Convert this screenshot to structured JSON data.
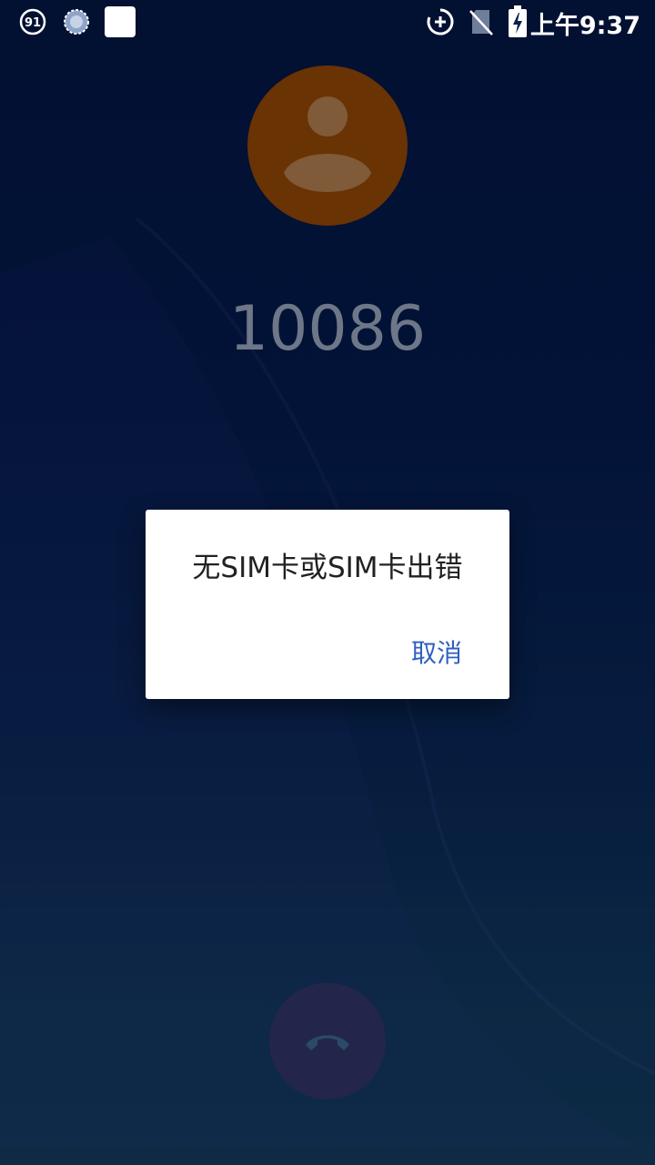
{
  "status_bar": {
    "time": "上午9:37",
    "icons": [
      "app-notification-icon",
      "sync-progress-icon",
      "blank-notification-icon",
      "data-saver-icon",
      "no-sim-icon",
      "battery-charging-icon"
    ]
  },
  "call": {
    "number": "10086",
    "avatar_icon": "default-contact-avatar-icon",
    "avatar_color": "#6a3303",
    "end_call_icon": "phone-hangup-icon"
  },
  "dialog": {
    "message": "无SIM卡或SIM卡出错",
    "cancel_label": "取消",
    "accent_color": "#2f5fc0"
  }
}
